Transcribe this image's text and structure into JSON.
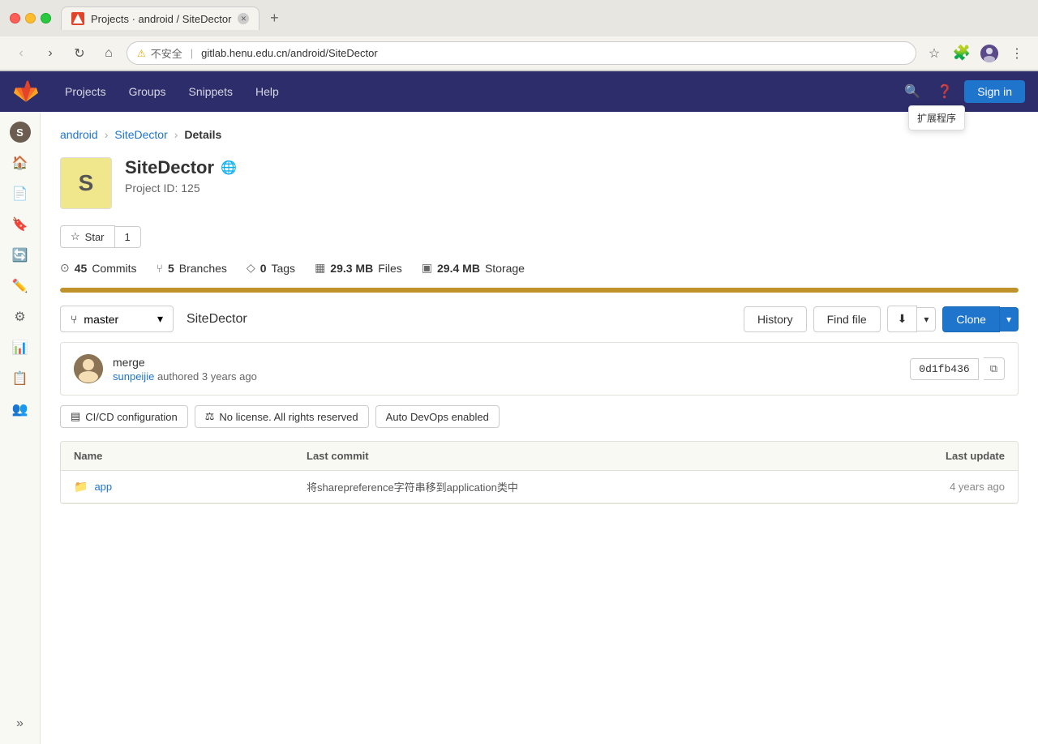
{
  "browser": {
    "tab_title": "Projects · android / SiteDector",
    "tab_new_label": "+",
    "url": "gitlab.henu.edu.cn/android/SiteDector",
    "url_warning": "不安全",
    "url_full": "gitlab.henu.edu.cn/android/SiteDector",
    "extension_tooltip": "扩展程序"
  },
  "topnav": {
    "projects_label": "Projects",
    "groups_label": "Groups",
    "snippets_label": "Snippets",
    "help_label": "Help",
    "signin_label": "Sign in"
  },
  "breadcrumb": {
    "android_label": "android",
    "sitedector_label": "SiteDector",
    "details_label": "Details"
  },
  "project": {
    "avatar_letter": "S",
    "title": "SiteDector",
    "project_id_label": "Project ID: 125"
  },
  "star": {
    "star_label": "Star",
    "count": "1"
  },
  "stats": {
    "commits_icon": "⊙",
    "commits_count": "45",
    "commits_label": "Commits",
    "branches_icon": "⑂",
    "branches_count": "5",
    "branches_label": "Branches",
    "tags_icon": "◇",
    "tags_count": "0",
    "tags_label": "Tags",
    "files_icon": "▦",
    "files_size": "29.3 MB",
    "files_label": "Files",
    "storage_icon": "▣",
    "storage_size": "29.4 MB",
    "storage_label": "Storage"
  },
  "toolbar": {
    "branch_name": "master",
    "repo_path": "SiteDector",
    "history_label": "History",
    "find_file_label": "Find file",
    "download_label": "⬇",
    "clone_label": "Clone"
  },
  "commit": {
    "message": "merge",
    "author": "sunpeijie",
    "authored_label": "authored",
    "time_ago": "3 years ago",
    "hash": "0d1fb436",
    "copy_icon": "⧉"
  },
  "notices": {
    "cicd_icon": "▤",
    "cicd_label": "CI/CD configuration",
    "license_icon": "⚖",
    "license_label": "No license. All rights reserved",
    "devops_label": "Auto DevOps enabled"
  },
  "file_table": {
    "col_name": "Name",
    "col_commit": "Last commit",
    "col_update": "Last update",
    "rows": [
      {
        "name": "app",
        "icon": "📁",
        "commit": "将sharepreference字符串移到application类中",
        "update": "4 years ago"
      }
    ]
  },
  "sidebar": {
    "avatar_letter": "S",
    "items": [
      {
        "icon": "🏠",
        "name": "home"
      },
      {
        "icon": "📄",
        "name": "snippets"
      },
      {
        "icon": "🔖",
        "name": "bookmarks"
      },
      {
        "icon": "🔄",
        "name": "merge-requests"
      },
      {
        "icon": "✏️",
        "name": "edit"
      },
      {
        "icon": "⚙",
        "name": "operations"
      },
      {
        "icon": "📊",
        "name": "analytics"
      },
      {
        "icon": "📋",
        "name": "registry"
      },
      {
        "icon": "👥",
        "name": "members"
      }
    ]
  },
  "colors": {
    "accent_blue": "#1f75cb",
    "gitlab_orange": "#e24329",
    "nav_dark": "#2d2d6b",
    "progress_gold": "#c0922b"
  }
}
